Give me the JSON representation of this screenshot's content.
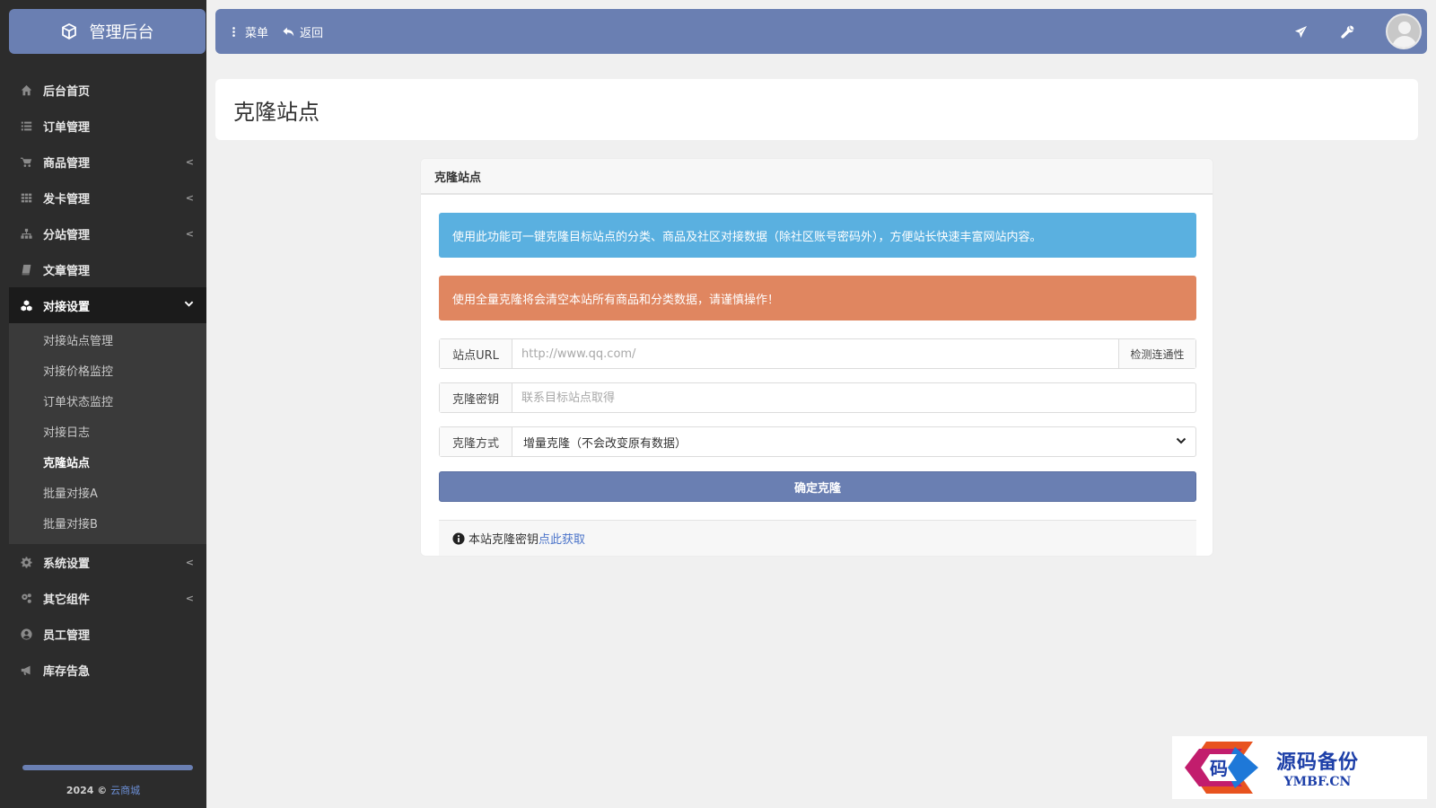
{
  "sidebar": {
    "brand": "管理后台",
    "items": [
      {
        "label": "后台首页",
        "icon": "home-icon"
      },
      {
        "label": "订单管理",
        "icon": "list-icon"
      },
      {
        "label": "商品管理",
        "icon": "cart-icon",
        "has_children": true
      },
      {
        "label": "发卡管理",
        "icon": "grid-icon",
        "has_children": true
      },
      {
        "label": "分站管理",
        "icon": "sitemap-icon",
        "has_children": true
      },
      {
        "label": "文章管理",
        "icon": "book-icon"
      },
      {
        "label": "对接设置",
        "icon": "cubes-icon",
        "expanded": true,
        "active": true
      },
      {
        "label": "系统设置",
        "icon": "gear-icon",
        "has_children": true
      },
      {
        "label": "其它组件",
        "icon": "gears-icon",
        "has_children": true
      },
      {
        "label": "员工管理",
        "icon": "user-circle-icon"
      },
      {
        "label": "库存告急",
        "icon": "bullhorn-icon"
      }
    ],
    "subitems": [
      {
        "label": "对接站点管理"
      },
      {
        "label": "对接价格监控"
      },
      {
        "label": "订单状态监控"
      },
      {
        "label": "对接日志"
      },
      {
        "label": "克隆站点",
        "current": true
      },
      {
        "label": "批量对接A"
      },
      {
        "label": "批量对接B"
      }
    ],
    "copyright_prefix": "2024 ©",
    "copyright_link": "云商城"
  },
  "topbar": {
    "menu_label": "菜单",
    "back_label": "返回",
    "right_icons": [
      "plane-icon",
      "wrench-icon"
    ]
  },
  "page": {
    "title": "克隆站点"
  },
  "panel": {
    "title": "克隆站点",
    "info_alert": "使用此功能可一键克隆目标站点的分类、商品及社区对接数据（除社区账号密码外），方便站长快速丰富网站内容。",
    "warn_alert": "使用全量克隆将会清空本站所有商品和分类数据，请谨慎操作！",
    "url_label": "站点URL",
    "url_placeholder": "http://www.qq.com/",
    "check_button": "检测连通性",
    "key_label": "克隆密钥",
    "key_placeholder": "联系目标站点取得",
    "mode_label": "克隆方式",
    "mode_selected": "增量克隆（不会改变原有数据）",
    "submit_label": "确定克隆",
    "footer_text": "本站克隆密钥",
    "footer_link": "点此获取"
  },
  "watermark": {
    "cn": "源码备份",
    "en": "YMBF.CN",
    "mark_char": "码"
  },
  "colors": {
    "primary": "#6a7fb2",
    "sidebar_bg": "#2c2c2c",
    "info": "#5ab0e0",
    "warning": "#e08660",
    "link": "#4a73c9"
  }
}
